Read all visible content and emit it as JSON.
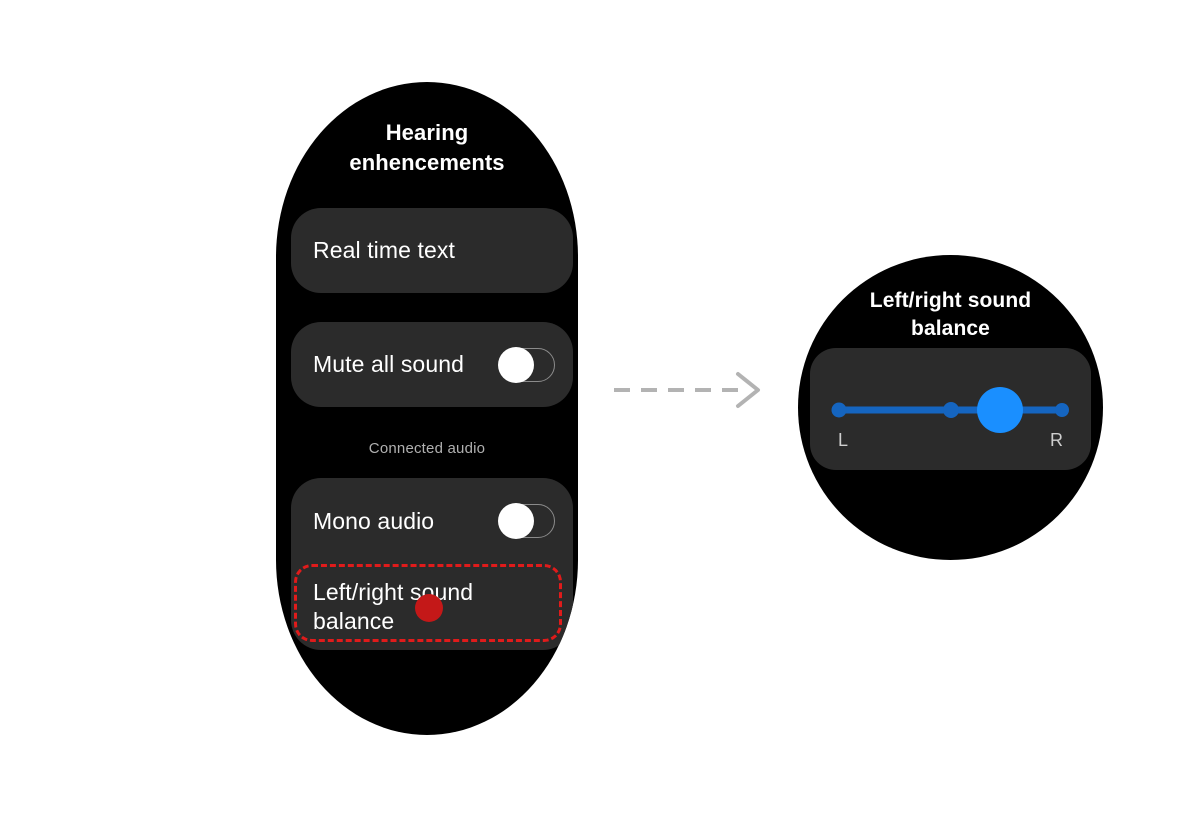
{
  "page": {
    "background_color": "#ffffff",
    "flow_arrow": {
      "icon": "dashed-right-arrow-icon",
      "color": "#b3b3b3",
      "direction": "right"
    }
  },
  "left_device": {
    "name": "hearing-enhancements-screen",
    "shape": "rounded-rectangle",
    "background_color": "#000000",
    "title": "Hearing\nenhencements",
    "title_line1": "Hearing",
    "title_line2": "enhencements",
    "items": [
      {
        "id": "real-time-text",
        "label": "Real time text",
        "type": "list-item",
        "has_toggle": false
      },
      {
        "id": "mute-all-sound",
        "label": "Mute all sound",
        "type": "toggle-item",
        "has_toggle": true,
        "toggle_state": "off"
      }
    ],
    "section_label": "Connected audio",
    "connected_audio_items": [
      {
        "id": "mono-audio",
        "label": "Mono audio",
        "type": "toggle-item",
        "has_toggle": true,
        "toggle_state": "off"
      },
      {
        "id": "left-right-sound-balance",
        "label": "Left/right sound balance",
        "label_line1": "Left/right sound",
        "label_line2": "balance",
        "type": "list-item",
        "has_toggle": false,
        "highlighted": true
      }
    ],
    "highlight": {
      "style": "dashed",
      "color": "#e01b1b",
      "target": "left-right-sound-balance"
    },
    "click_marker": {
      "color": "#c41818",
      "shape": "circle"
    },
    "card_color": "#2b2b2b",
    "text_color": "#ffffff",
    "section_label_color": "#b0b0b0"
  },
  "right_device": {
    "name": "left-right-sound-balance-screen",
    "shape": "circle",
    "background_color": "#000000",
    "title": "Left/right sound balance",
    "title_line1": "Left/right sound",
    "title_line2": "balance",
    "slider": {
      "name": "left-right-balance-slider",
      "min_label": "L",
      "max_label": "R",
      "accent_color": "#1a8fff",
      "track_color": "#1565c0",
      "value_percent": 72,
      "center_tick_percent": 50,
      "card_color": "#2b2b2b"
    }
  }
}
